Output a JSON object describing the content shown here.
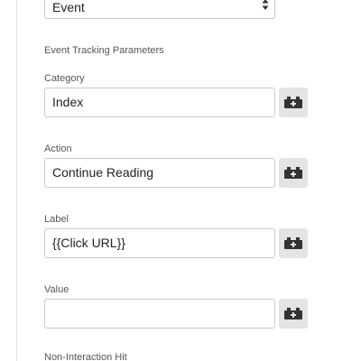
{
  "track_type": {
    "value": "Event"
  },
  "section_title": "Event Tracking Parameters",
  "fields": [
    {
      "label": "Category",
      "value": "Index",
      "icon": "add-variable-icon"
    },
    {
      "label": "Action",
      "value": "Continue Reading",
      "icon": "add-variable-icon"
    },
    {
      "label": "Label",
      "value": "{{Click URL}}",
      "icon": "add-variable-icon"
    },
    {
      "label": "Value",
      "value": "",
      "icon": "add-variable-icon"
    }
  ],
  "non_interaction_label": "Non-Interaction Hit"
}
